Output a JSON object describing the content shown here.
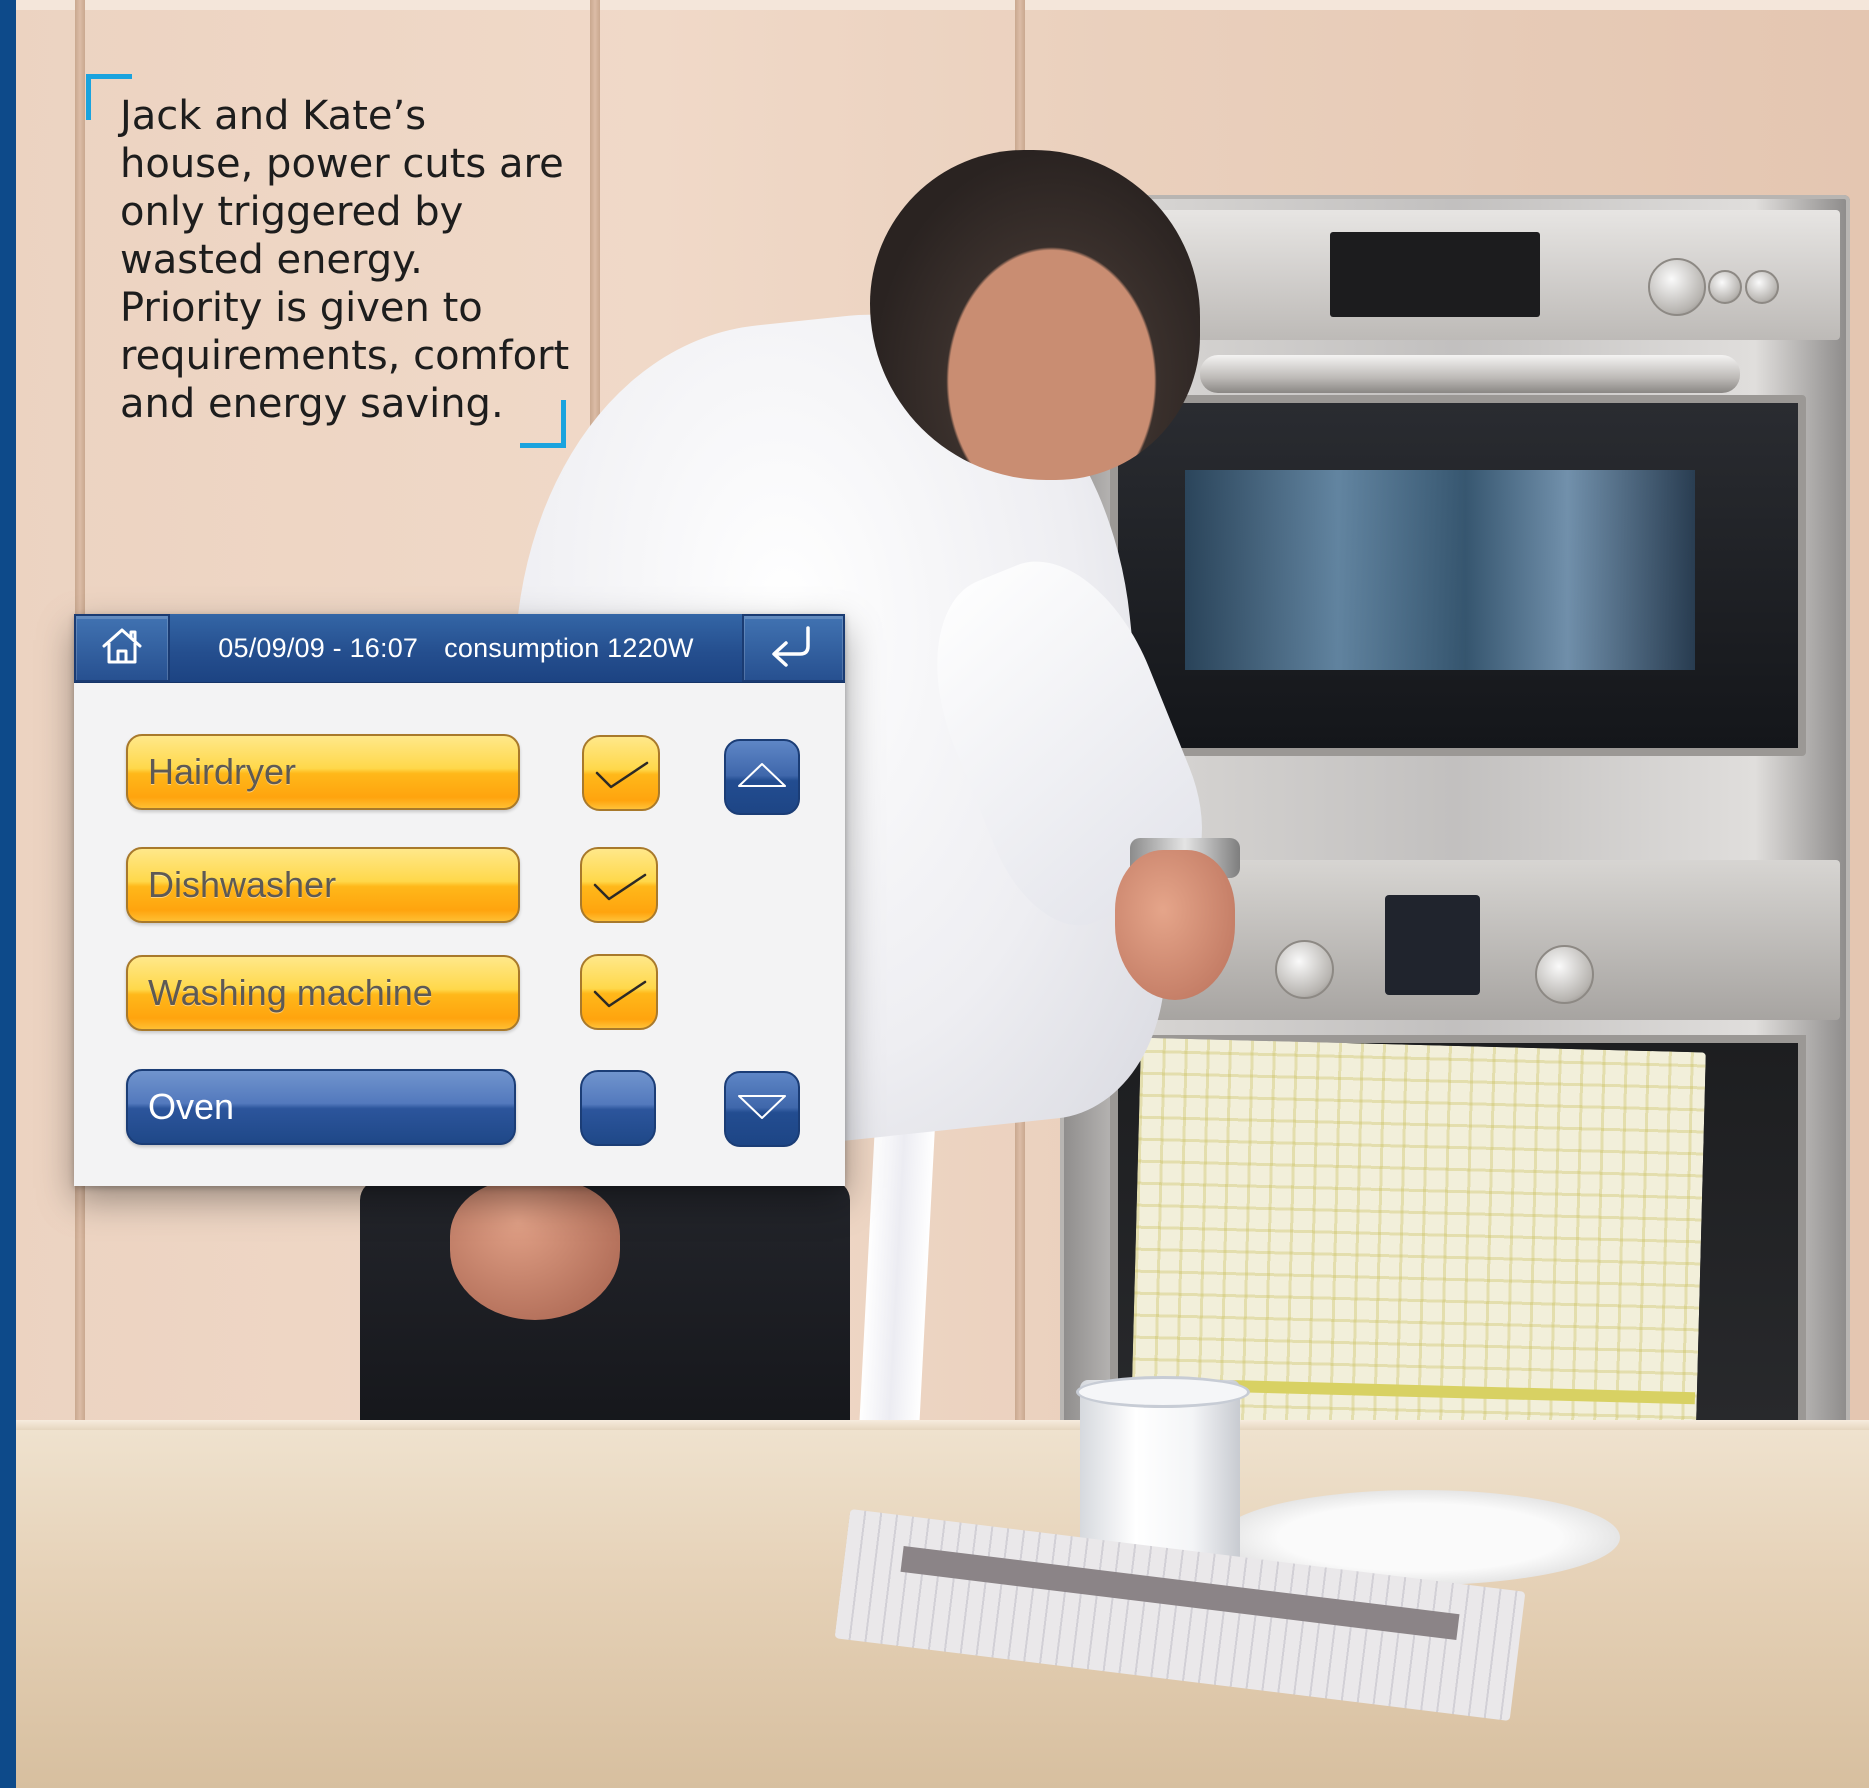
{
  "caption": {
    "text": "Jack and Kate’s house, power cuts are only triggered by wasted energy. Priority is given to requirements, comfort and energy saving."
  },
  "header": {
    "datetime": "05/09/09 - 16:07",
    "consumption": "consumption 1220W",
    "home_icon": "home-icon",
    "back_icon": "return-arrow-icon"
  },
  "devices": [
    {
      "label": "Hairdryer",
      "enabled": true
    },
    {
      "label": "Dishwasher",
      "enabled": true
    },
    {
      "label": "Washing machine",
      "enabled": true
    },
    {
      "label": "Oven",
      "enabled": false
    }
  ],
  "scroll": {
    "up_icon": "scroll-up-icon",
    "down_icon": "scroll-down-icon"
  },
  "colors": {
    "accent_blue": "#254f8f",
    "active_yellow": "#ffc22a",
    "bracket_cyan": "#1aa3de",
    "side_stripe": "#0d4a8a"
  }
}
